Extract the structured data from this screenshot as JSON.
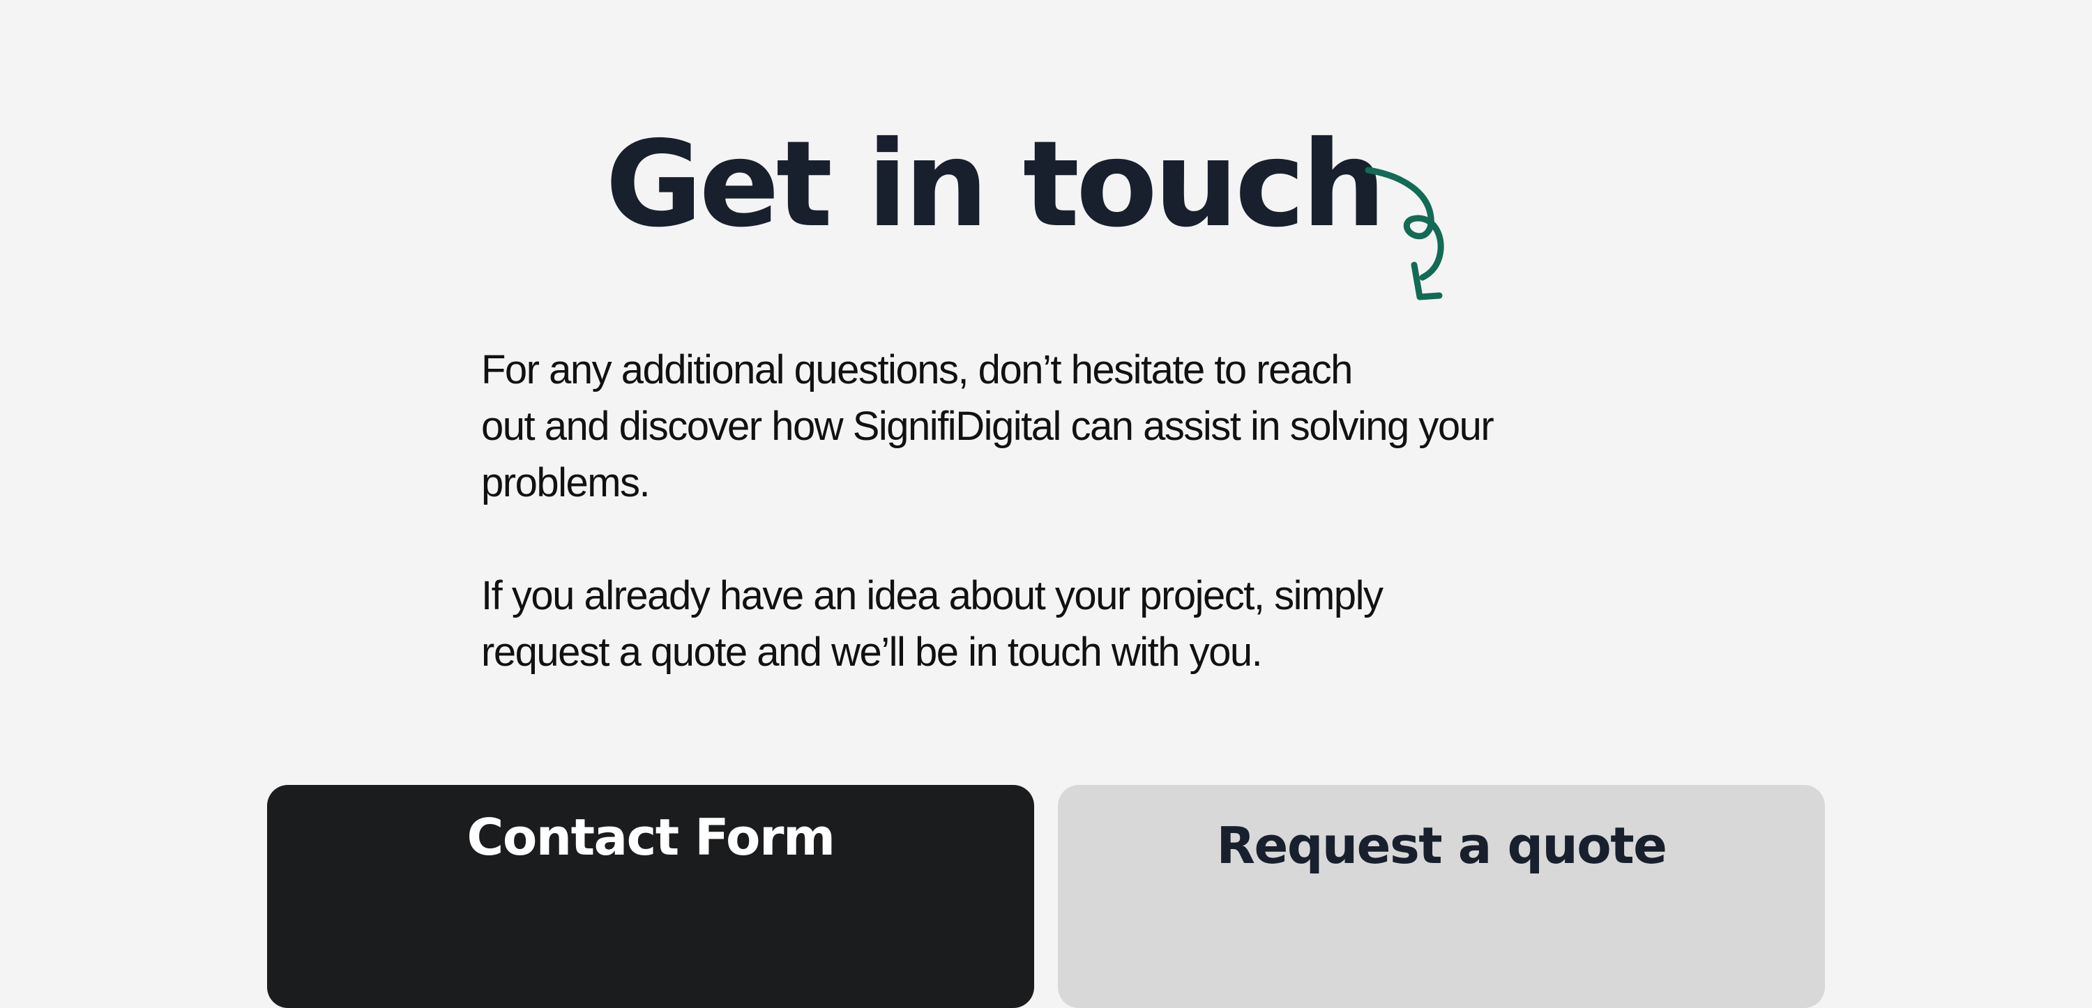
{
  "hero": {
    "title": "Get in touch"
  },
  "intro": {
    "paragraph1_lines": [
      "For any additional questions, don’t hesitate to reach",
      "out and discover how SignifiDigital can assist in solving your",
      "problems."
    ],
    "paragraph2_lines": [
      "If you already have an idea about your project, simply",
      "request a quote and we’ll be in touch with you."
    ]
  },
  "cards": {
    "contact": {
      "title": "Contact Form"
    },
    "quote": {
      "title": "Request a quote"
    }
  },
  "colors": {
    "background": "#f4f4f4",
    "heading": "#18202e",
    "accent_arrow": "#136a55",
    "card_dark": "#1b1c1e",
    "card_light": "#d8d8d8"
  },
  "icons": {
    "decorative_arrow": "curly-arrow-down-icon"
  }
}
